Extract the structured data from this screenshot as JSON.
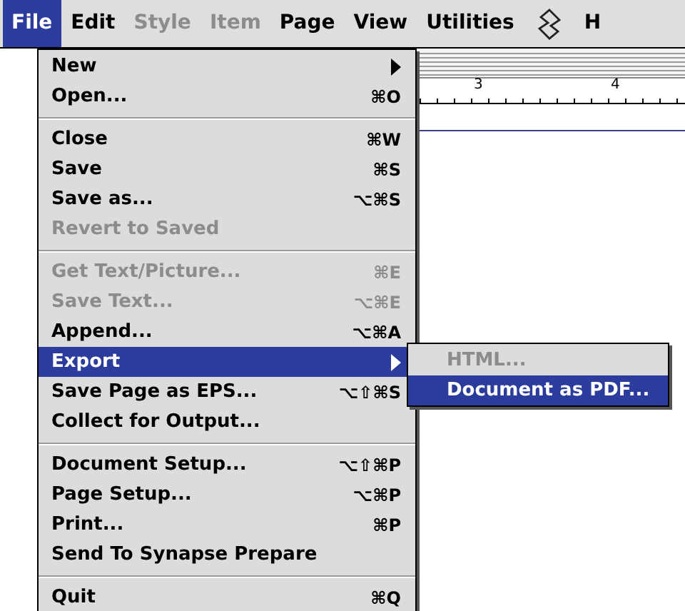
{
  "menubar": [
    {
      "kind": "text",
      "label": "File",
      "selected": true,
      "disabled": false
    },
    {
      "kind": "text",
      "label": "Edit",
      "selected": false,
      "disabled": false
    },
    {
      "kind": "text",
      "label": "Style",
      "selected": false,
      "disabled": true
    },
    {
      "kind": "text",
      "label": "Item",
      "selected": false,
      "disabled": true
    },
    {
      "kind": "text",
      "label": "Page",
      "selected": false,
      "disabled": false
    },
    {
      "kind": "text",
      "label": "View",
      "selected": false,
      "disabled": false
    },
    {
      "kind": "text",
      "label": "Utilities",
      "selected": false,
      "disabled": false
    },
    {
      "kind": "icon",
      "selected": false,
      "disabled": false
    },
    {
      "kind": "text",
      "label": "H",
      "selected": false,
      "disabled": false
    }
  ],
  "ruler": {
    "labels": [
      "3",
      "4"
    ]
  },
  "menu": {
    "groups": [
      [
        {
          "label": "New",
          "disabled": false,
          "selected": false,
          "submenu": true
        },
        {
          "label": "Open...",
          "shortcut": "⌘O",
          "disabled": false,
          "selected": false,
          "submenu": false
        }
      ],
      [
        {
          "label": "Close",
          "shortcut": "⌘W",
          "disabled": false,
          "selected": false,
          "submenu": false
        },
        {
          "label": "Save",
          "shortcut": "⌘S",
          "disabled": false,
          "selected": false,
          "submenu": false
        },
        {
          "label": "Save as...",
          "shortcut": "⌥⌘S",
          "disabled": false,
          "selected": false,
          "submenu": false
        },
        {
          "label": "Revert to Saved",
          "disabled": true,
          "selected": false,
          "submenu": false
        }
      ],
      [
        {
          "label": "Get Text/Picture...",
          "shortcut": "⌘E",
          "disabled": true,
          "selected": false,
          "submenu": false
        },
        {
          "label": "Save Text...",
          "shortcut": "⌥⌘E",
          "disabled": true,
          "selected": false,
          "submenu": false
        },
        {
          "label": "Append...",
          "shortcut": "⌥⌘A",
          "disabled": false,
          "selected": false,
          "submenu": false
        },
        {
          "label": "Export",
          "disabled": false,
          "selected": true,
          "submenu": true
        },
        {
          "label": "Save Page as EPS...",
          "shortcut": "⌥⇧⌘S",
          "disabled": false,
          "selected": false,
          "submenu": false
        },
        {
          "label": "Collect for Output...",
          "disabled": false,
          "selected": false,
          "submenu": false
        }
      ],
      [
        {
          "label": "Document Setup...",
          "shortcut": "⌥⇧⌘P",
          "disabled": false,
          "selected": false,
          "submenu": false
        },
        {
          "label": "Page Setup...",
          "shortcut": "⌥⌘P",
          "disabled": false,
          "selected": false,
          "submenu": false
        },
        {
          "label": "Print...",
          "shortcut": "⌘P",
          "disabled": false,
          "selected": false,
          "submenu": false
        },
        {
          "label": "Send To Synapse Prepare",
          "disabled": false,
          "selected": false,
          "submenu": false
        }
      ],
      [
        {
          "label": "Quit",
          "shortcut": "⌘Q",
          "disabled": false,
          "selected": false,
          "submenu": false
        }
      ]
    ]
  },
  "submenu": {
    "items": [
      {
        "label": "HTML...",
        "disabled": true,
        "selected": false
      },
      {
        "label": "Document as PDF...",
        "disabled": false,
        "selected": true
      }
    ]
  }
}
